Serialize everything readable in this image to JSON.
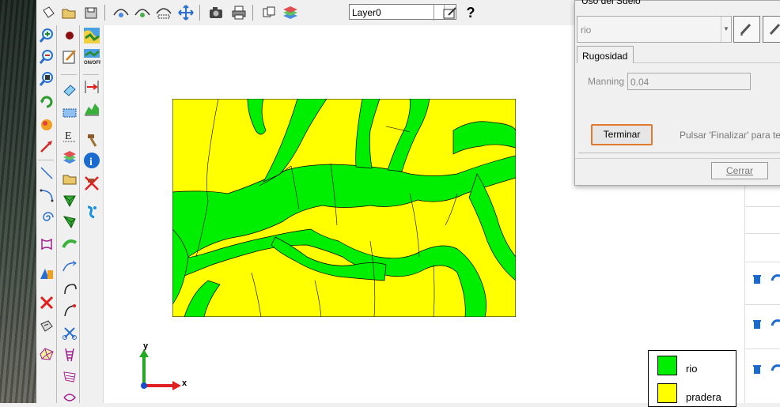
{
  "toolbar": {
    "layer_value": "Layer0",
    "icons": [
      "new-file-icon",
      "open-folder-icon",
      "save-icon",
      "zoom-extent-icon",
      "zoom-previous-icon",
      "zoom-window-icon",
      "pan-icon",
      "camera-icon",
      "print-icon",
      "layers-manager-icon",
      "layers-stack-icon",
      "pencil-edit-icon",
      "help-icon"
    ]
  },
  "left_tools": {
    "icons": [
      "zoom-in-icon",
      "zoom-out-icon",
      "zoom-realtime-icon",
      "regenerate-icon",
      "render-icon",
      "arrow-icon",
      "line-icon",
      "arc-icon",
      "spiral-icon",
      "polygon-icon",
      "solid-icon",
      "delete-icon",
      "properties-icon",
      "mesh-icon",
      "brown-point-icon",
      "edit-sheet-icon",
      "eraser-icon",
      "select-box-icon",
      "text-icon",
      "layers-icon",
      "folder-icon",
      "mesh-tri-icon",
      "mesh-edit-icon",
      "path-icon",
      "curve-icon",
      "scissors-icon",
      "ladder-icon",
      "map-color-icon",
      "onoff-icon",
      "measure-icon",
      "profile-icon",
      "hammer-icon",
      "info-icon",
      "delete-tool-icon",
      "water-icon"
    ]
  },
  "axes": {
    "x": "x",
    "y": "y"
  },
  "legend": {
    "items": [
      {
        "label": "rio",
        "color": "#00ee00"
      },
      {
        "label": "pradera",
        "color": "#ffff00"
      }
    ]
  },
  "dialog": {
    "title": "Uso del Suelo",
    "use_value": "rio",
    "tab": "Rugosidad",
    "manning_label": "Manning",
    "manning_value": "0.04",
    "terminar": "Terminar",
    "finalize_text": "Pulsar 'Finalizar' para ter",
    "cerrar": "Cerrar"
  },
  "colors": {
    "rio": "#00ee00",
    "pradera": "#ffff00",
    "accent": "#e07a2e"
  }
}
